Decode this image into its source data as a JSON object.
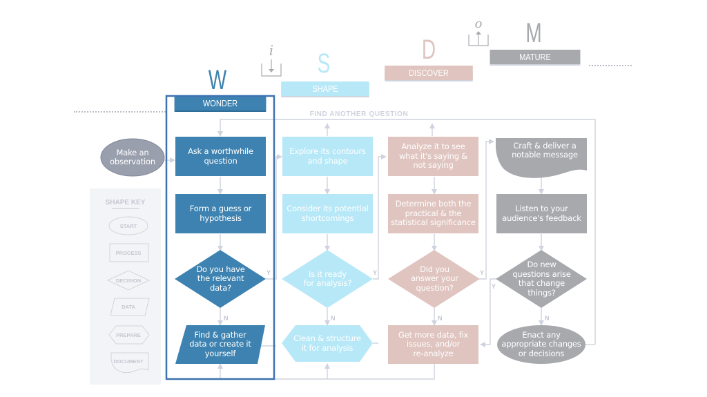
{
  "colors": {
    "wonder": "#3d82b0",
    "shape": "#b7e8f7",
    "discover": "#dfc4bf",
    "mature": "#a7a9ad",
    "observe": "#9a9fae",
    "connector": "#cfd3de",
    "key_bg": "#f3f4f7",
    "wonder_outline": "#3d72b0"
  },
  "stages": [
    {
      "letter": "W",
      "label": "WONDER"
    },
    {
      "letter": "S",
      "label": "SHAPE"
    },
    {
      "letter": "D",
      "label": "DISCOVER"
    },
    {
      "letter": "M",
      "label": "MATURE"
    }
  ],
  "input_icon": {
    "glyph": "i",
    "name": "input-icon"
  },
  "output_icon": {
    "glyph": "o",
    "name": "output-icon"
  },
  "loop_label": "FIND ANOTHER QUESTION",
  "start_node": "Make an\nobservation",
  "wonder_nodes": {
    "ask": "Ask a worthwhile\nquestion",
    "form": "Form a guess or\nhypothesis",
    "decision": "Do you have\nthe relevant\ndata?",
    "gather": "Find & gather\ndata or create it\nyourself"
  },
  "shape_nodes": {
    "explore": "Explore its contours\nand shape",
    "consider": "Consider its potential\nshortcomings",
    "decision": "Is it ready\nfor analysis?",
    "clean": "Clean & structure\nit for analysis"
  },
  "discover_nodes": {
    "analyze": "Analyze it to see\nwhat it's saying &\nnot saying",
    "determine": "Determine both the\npractical &  the\nstatistical significance",
    "decision": "Did you\nanswer your\nquestion?",
    "more": "Get more data, fix\nissues, and/or\nre-analyze"
  },
  "mature_nodes": {
    "craft": "Craft & deliver a\nnotable message",
    "listen": "Listen to your\naudience's feedback",
    "decision": "Do new\nquestions arise\nthat change\nthings?",
    "enact": "Enact any\nappropriate changes\nor decisions"
  },
  "branch_labels": {
    "yes": "Y",
    "no": "N"
  },
  "shape_key": {
    "title": "SHAPE KEY",
    "items": [
      "START",
      "PROCESS",
      "DECISION",
      "DATA",
      "PREPARE",
      "DOCUMENT"
    ]
  }
}
